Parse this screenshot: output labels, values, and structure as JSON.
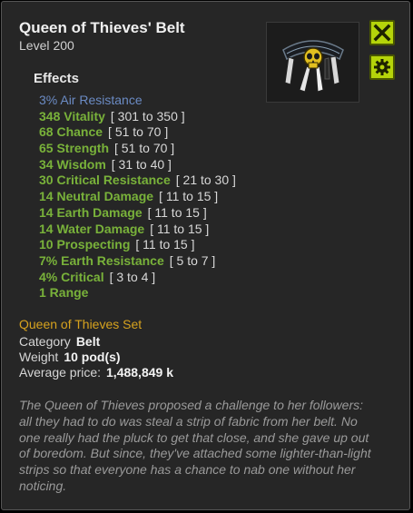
{
  "item": {
    "name": "Queen of Thieves' Belt",
    "level_label": "Level",
    "level_value": "200"
  },
  "effects_heading": "Effects",
  "effects": [
    {
      "name": "3% Air Resistance",
      "range": "",
      "color": "#6b8bc4"
    },
    {
      "name": "348 Vitality",
      "range": "[ 301 to 350 ]",
      "color": "#79b23a"
    },
    {
      "name": "68 Chance",
      "range": "[ 51 to 70 ]",
      "color": "#79b23a"
    },
    {
      "name": "65 Strength",
      "range": "[ 51 to 70 ]",
      "color": "#79b23a"
    },
    {
      "name": "34 Wisdom",
      "range": "[ 31 to 40 ]",
      "color": "#79b23a"
    },
    {
      "name": "30 Critical Resistance",
      "range": "[ 21 to 30 ]",
      "color": "#79b23a"
    },
    {
      "name": "14 Neutral Damage",
      "range": "[ 11 to 15 ]",
      "color": "#79b23a"
    },
    {
      "name": "14 Earth Damage",
      "range": "[ 11 to 15 ]",
      "color": "#79b23a"
    },
    {
      "name": "14 Water Damage",
      "range": "[ 11 to 15 ]",
      "color": "#79b23a"
    },
    {
      "name": "10 Prospecting",
      "range": "[ 11 to 15 ]",
      "color": "#79b23a"
    },
    {
      "name": "7% Earth Resistance",
      "range": "[ 5 to 7 ]",
      "color": "#79b23a"
    },
    {
      "name": "4% Critical",
      "range": "[ 3 to 4 ]",
      "color": "#79b23a"
    },
    {
      "name": "1 Range",
      "range": "",
      "color": "#79b23a"
    }
  ],
  "set_name": "Queen of Thieves Set",
  "properties": {
    "category_label": "Category",
    "category_value": "Belt",
    "weight_label": "Weight",
    "weight_value": "10 pod(s)",
    "price_label": "Average price:",
    "price_value": "1,488,849 k"
  },
  "description": "The Queen of Thieves proposed a challenge to her followers: all they had to do was steal a strip of fabric from her belt. No one really had the pluck to get that close, and she gave up out of boredom. But since, they've attached some lighter-than-light strips so that everyone has a chance to nab one without her noticing.",
  "icons": {
    "close": "close-x-icon",
    "settings": "gear-icon",
    "item": "skull-belt-icon"
  },
  "colors": {
    "accent_button": "#b5d40a",
    "set_name": "#d6a21e",
    "effect_positive": "#79b23a",
    "effect_neutral": "#6b8bc4"
  }
}
